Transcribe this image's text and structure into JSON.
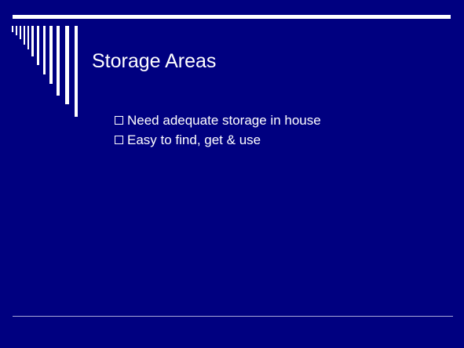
{
  "slide": {
    "title": "Storage Areas",
    "bullets": [
      {
        "icon": "hollow-square-bullet-icon",
        "text": "Need adequate storage in house"
      },
      {
        "icon": "hollow-square-bullet-icon",
        "text": "Easy to find, get & use"
      }
    ]
  },
  "colors": {
    "background": "#000080",
    "text": "#ffffff",
    "accent_rule": "#ffffff",
    "footer_rule": "#a8a8d8"
  }
}
